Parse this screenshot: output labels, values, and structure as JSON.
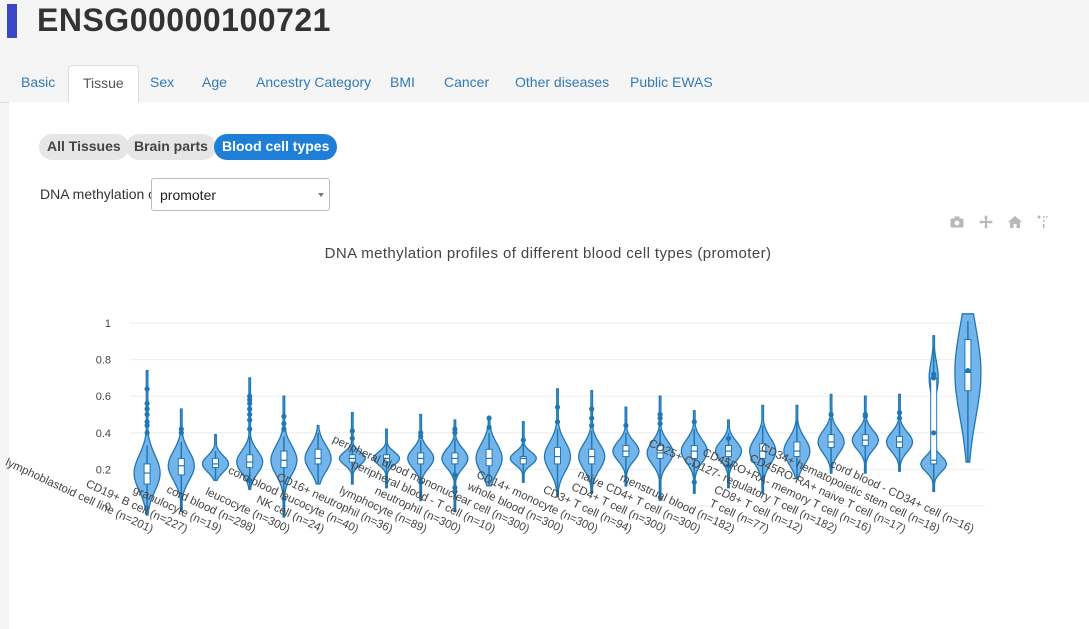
{
  "header": {
    "title": "ENSG00000100721"
  },
  "tabs": [
    "Basic",
    "Tissue",
    "Sex",
    "Age",
    "Ancestry Category",
    "BMI",
    "Cancer",
    "Other diseases",
    "Public EWAS"
  ],
  "active_tab": "Tissue",
  "pills": [
    "All Tissues",
    "Brain parts",
    "Blood cell types"
  ],
  "active_pill": "Blood cell types",
  "dna_label": "DNA methylation of",
  "dna_select_value": "promoter",
  "modebar": [
    "camera-icon",
    "pan-icon",
    "home-icon",
    "spike-icon"
  ],
  "colors": {
    "violet_stroke": "#1f77b4",
    "violet_fill": "#5aa8e8",
    "accent": "#1f7fd6",
    "title_bar": "#3a47c5"
  },
  "chart_data": {
    "type": "violin",
    "title": "DNA methylation profiles of different blood cell types (promoter)",
    "yticks": [
      "0",
      "0.2",
      "0.4",
      "0.6",
      "0.8",
      "1"
    ],
    "ylim": [
      -0.05,
      1.05
    ],
    "grid": true,
    "categories": [
      {
        "label": "lymphoblastoid cell line (n=201)",
        "min": -0.05,
        "q1": 0.12,
        "median": 0.18,
        "q3": 0.23,
        "max": 0.74,
        "upper": 0.33,
        "outliers": [
          0.4,
          0.44,
          0.46,
          0.5,
          0.53,
          0.56,
          0.64
        ]
      },
      {
        "label": "CD19+ B cell (n=227)",
        "min": -0.03,
        "q1": 0.17,
        "median": 0.22,
        "q3": 0.26,
        "max": 0.53,
        "upper": 0.35,
        "outliers": [
          0.4,
          0.42
        ]
      },
      {
        "label": "granulocyte (n=19)",
        "min": 0.14,
        "q1": 0.21,
        "median": 0.23,
        "q3": 0.26,
        "max": 0.39,
        "upper": 0.3,
        "outliers": []
      },
      {
        "label": "cord blood (n=298)",
        "min": 0.09,
        "q1": 0.21,
        "median": 0.24,
        "q3": 0.28,
        "max": 0.7,
        "upper": 0.38,
        "outliers": [
          0.14,
          0.42,
          0.47,
          0.5,
          0.53,
          0.56,
          0.58,
          0.6
        ]
      },
      {
        "label": "leucocyte (n=300)",
        "min": -0.06,
        "q1": 0.21,
        "median": 0.25,
        "q3": 0.3,
        "max": 0.6,
        "upper": 0.38,
        "outliers": [
          0.04,
          0.42,
          0.45,
          0.49
        ]
      },
      {
        "label": "NK cell (n=24)",
        "min": 0.12,
        "q1": 0.23,
        "median": 0.26,
        "q3": 0.31,
        "max": 0.44,
        "upper": 0.4,
        "outliers": []
      },
      {
        "label": "cord blood leucocyte (n=40)",
        "min": 0.12,
        "q1": 0.24,
        "median": 0.26,
        "q3": 0.28,
        "max": 0.51,
        "upper": 0.33,
        "outliers": [
          0.37,
          0.41
        ]
      },
      {
        "label": "CD16+ neutrophil (n=36)",
        "min": 0.1,
        "q1": 0.24,
        "median": 0.26,
        "q3": 0.28,
        "max": 0.42,
        "upper": 0.34,
        "outliers": []
      },
      {
        "label": "lymphocyte (n=89)",
        "min": 0.03,
        "q1": 0.23,
        "median": 0.26,
        "q3": 0.29,
        "max": 0.5,
        "upper": 0.36,
        "outliers": [
          0.13,
          0.38,
          0.4
        ]
      },
      {
        "label": "neutrophil (n=300)",
        "min": -0.03,
        "q1": 0.23,
        "median": 0.26,
        "q3": 0.29,
        "max": 0.47,
        "upper": 0.37,
        "outliers": [
          0.08,
          0.1,
          0.17,
          0.4,
          0.42
        ]
      },
      {
        "label": "peripheral blood - T cell (n=10)",
        "min": 0.11,
        "q1": 0.22,
        "median": 0.26,
        "q3": 0.31,
        "max": 0.49,
        "upper": 0.4,
        "outliers": [
          0.43,
          0.48
        ]
      },
      {
        "label": "peripheral blood mononuclear cell (n=300)",
        "min": 0.13,
        "q1": 0.23,
        "median": 0.26,
        "q3": 0.27,
        "max": 0.46,
        "upper": 0.34,
        "outliers": [
          0.36
        ]
      },
      {
        "label": "whole blood (n=300)",
        "min": 0.05,
        "q1": 0.23,
        "median": 0.27,
        "q3": 0.32,
        "max": 0.64,
        "upper": 0.42,
        "outliers": [
          0.46,
          0.54
        ]
      },
      {
        "label": "CD14+ monocyte (n=300)",
        "min": 0.07,
        "q1": 0.23,
        "median": 0.27,
        "q3": 0.31,
        "max": 0.63,
        "upper": 0.41,
        "outliers": [
          0.44,
          0.48,
          0.53
        ]
      },
      {
        "label": "CD3+ T cell (n=94)",
        "min": 0.11,
        "q1": 0.27,
        "median": 0.3,
        "q3": 0.33,
        "max": 0.54,
        "upper": 0.4,
        "outliers": [
          0.44
        ]
      },
      {
        "label": "CD4+ T cell (n=300)",
        "min": 0.03,
        "q1": 0.26,
        "median": 0.29,
        "q3": 0.33,
        "max": 0.6,
        "upper": 0.42,
        "outliers": [
          0.45,
          0.48,
          0.5
        ]
      },
      {
        "label": "naive CD4+ T cell (n=300)",
        "min": 0.07,
        "q1": 0.26,
        "median": 0.3,
        "q3": 0.33,
        "max": 0.52,
        "upper": 0.42,
        "outliers": [
          0.13,
          0.46
        ]
      },
      {
        "label": "menstrual blood (n=182)",
        "min": 0.1,
        "q1": 0.27,
        "median": 0.3,
        "q3": 0.33,
        "max": 0.47,
        "upper": 0.4,
        "outliers": [
          0.22,
          0.37
        ]
      },
      {
        "label": "T cell (n=77)",
        "min": 0.07,
        "q1": 0.26,
        "median": 0.3,
        "q3": 0.34,
        "max": 0.55,
        "upper": 0.44,
        "outliers": []
      },
      {
        "label": "CD8+ T cell (n=12)",
        "min": 0.15,
        "q1": 0.27,
        "median": 0.3,
        "q3": 0.35,
        "max": 0.55,
        "upper": 0.47,
        "outliers": []
      },
      {
        "label": "CD25+ CD127- regulatory T cell (n=182)",
        "min": 0.18,
        "q1": 0.32,
        "median": 0.35,
        "q3": 0.39,
        "max": 0.61,
        "upper": 0.48,
        "outliers": [
          0.5
        ]
      },
      {
        "label": "CD45RO+RA- memory T cell (n=16)",
        "min": 0.18,
        "q1": 0.33,
        "median": 0.36,
        "q3": 0.39,
        "max": 0.6,
        "upper": 0.47,
        "outliers": [
          0.49,
          0.5
        ]
      },
      {
        "label": "CD45RO-RA+ naive T cell (n=17)",
        "min": 0.19,
        "q1": 0.32,
        "median": 0.35,
        "q3": 0.38,
        "max": 0.61,
        "upper": 0.46,
        "outliers": [
          0.48,
          0.51
        ]
      },
      {
        "label": "CD34+ hematopoietic stem cell (n=18)",
        "min": 0.08,
        "q1": 0.23,
        "median": 0.25,
        "q3": 0.7,
        "max": 0.93,
        "upper": 0.88,
        "outliers": [
          0.4,
          0.7,
          0.72
        ]
      },
      {
        "label": "cord blood - CD34+ cell (n=16)",
        "min": 0.24,
        "q1": 0.63,
        "median": 0.73,
        "q3": 0.91,
        "max": 1.05,
        "upper": 1.01,
        "outliers": [
          0.74
        ]
      }
    ]
  }
}
